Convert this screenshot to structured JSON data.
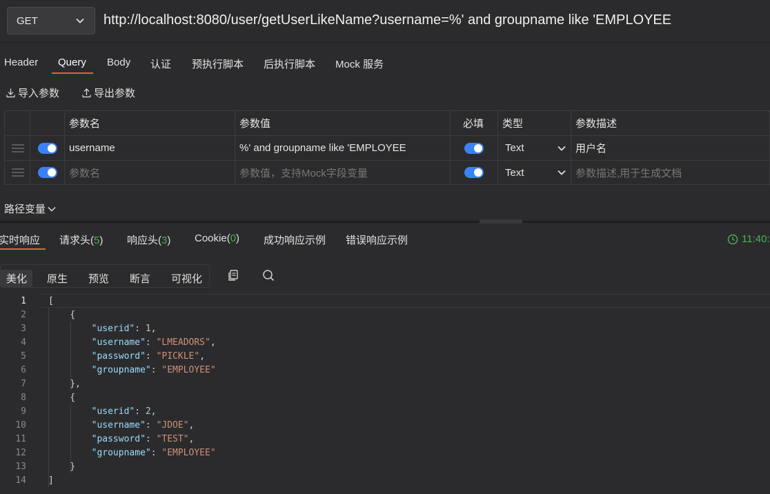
{
  "request": {
    "method": "GET",
    "url": "http://localhost:8080/user/getUserLikeName?username=%' and groupname like 'EMPLOYEE"
  },
  "req_tabs": [
    "Header",
    "Query",
    "Body",
    "认证",
    "预执行脚本",
    "后执行脚本",
    "Mock 服务"
  ],
  "tools": {
    "import": "导入参数",
    "export": "导出参数"
  },
  "params": {
    "headers": {
      "name": "参数名",
      "value": "参数值",
      "required": "必填",
      "type": "类型",
      "desc": "参数描述"
    },
    "rows": [
      {
        "name": "username",
        "value": "%' and groupname like 'EMPLOYEE",
        "type": "Text",
        "desc": "用户名"
      }
    ],
    "empty_row": {
      "name_placeholder": "参数名",
      "value_placeholder": "参数值，支持Mock字段变量",
      "type": "Text",
      "desc_placeholder": "参数描述,用于生成文档"
    }
  },
  "path_var": "路径变量",
  "res_tabs": {
    "realtime": "实时响应",
    "req_headers": "请求头(",
    "req_headers_count": "5",
    "res_headers": "响应头(",
    "res_headers_count": "3",
    "cookie": "Cookie(",
    "cookie_count": "0",
    "close": ")",
    "success_example": "成功响应示例",
    "error_example": "错误响应示例",
    "time": "11:40:"
  },
  "view_modes": [
    "美化",
    "原生",
    "预览",
    "断言",
    "可视化"
  ],
  "code": {
    "line_numbers": [
      "1",
      "2",
      "3",
      "4",
      "5",
      "6",
      "7",
      "8",
      "9",
      "10",
      "11",
      "12",
      "13",
      "14"
    ],
    "users": [
      {
        "userid": "1",
        "username": "\"LMEADORS\"",
        "password": "\"PICKLE\"",
        "groupname": "\"EMPLOYEE\""
      },
      {
        "userid": "2",
        "username": "\"JDOE\"",
        "password": "\"TEST\"",
        "groupname": "\"EMPLOYEE\""
      }
    ],
    "keys": {
      "userid": "\"userid\"",
      "username": "\"username\"",
      "password": "\"password\"",
      "groupname": "\"groupname\""
    }
  },
  "colors": {
    "accent": "#e0643c",
    "toggle": "#3b82f6",
    "success": "#4caf50"
  }
}
